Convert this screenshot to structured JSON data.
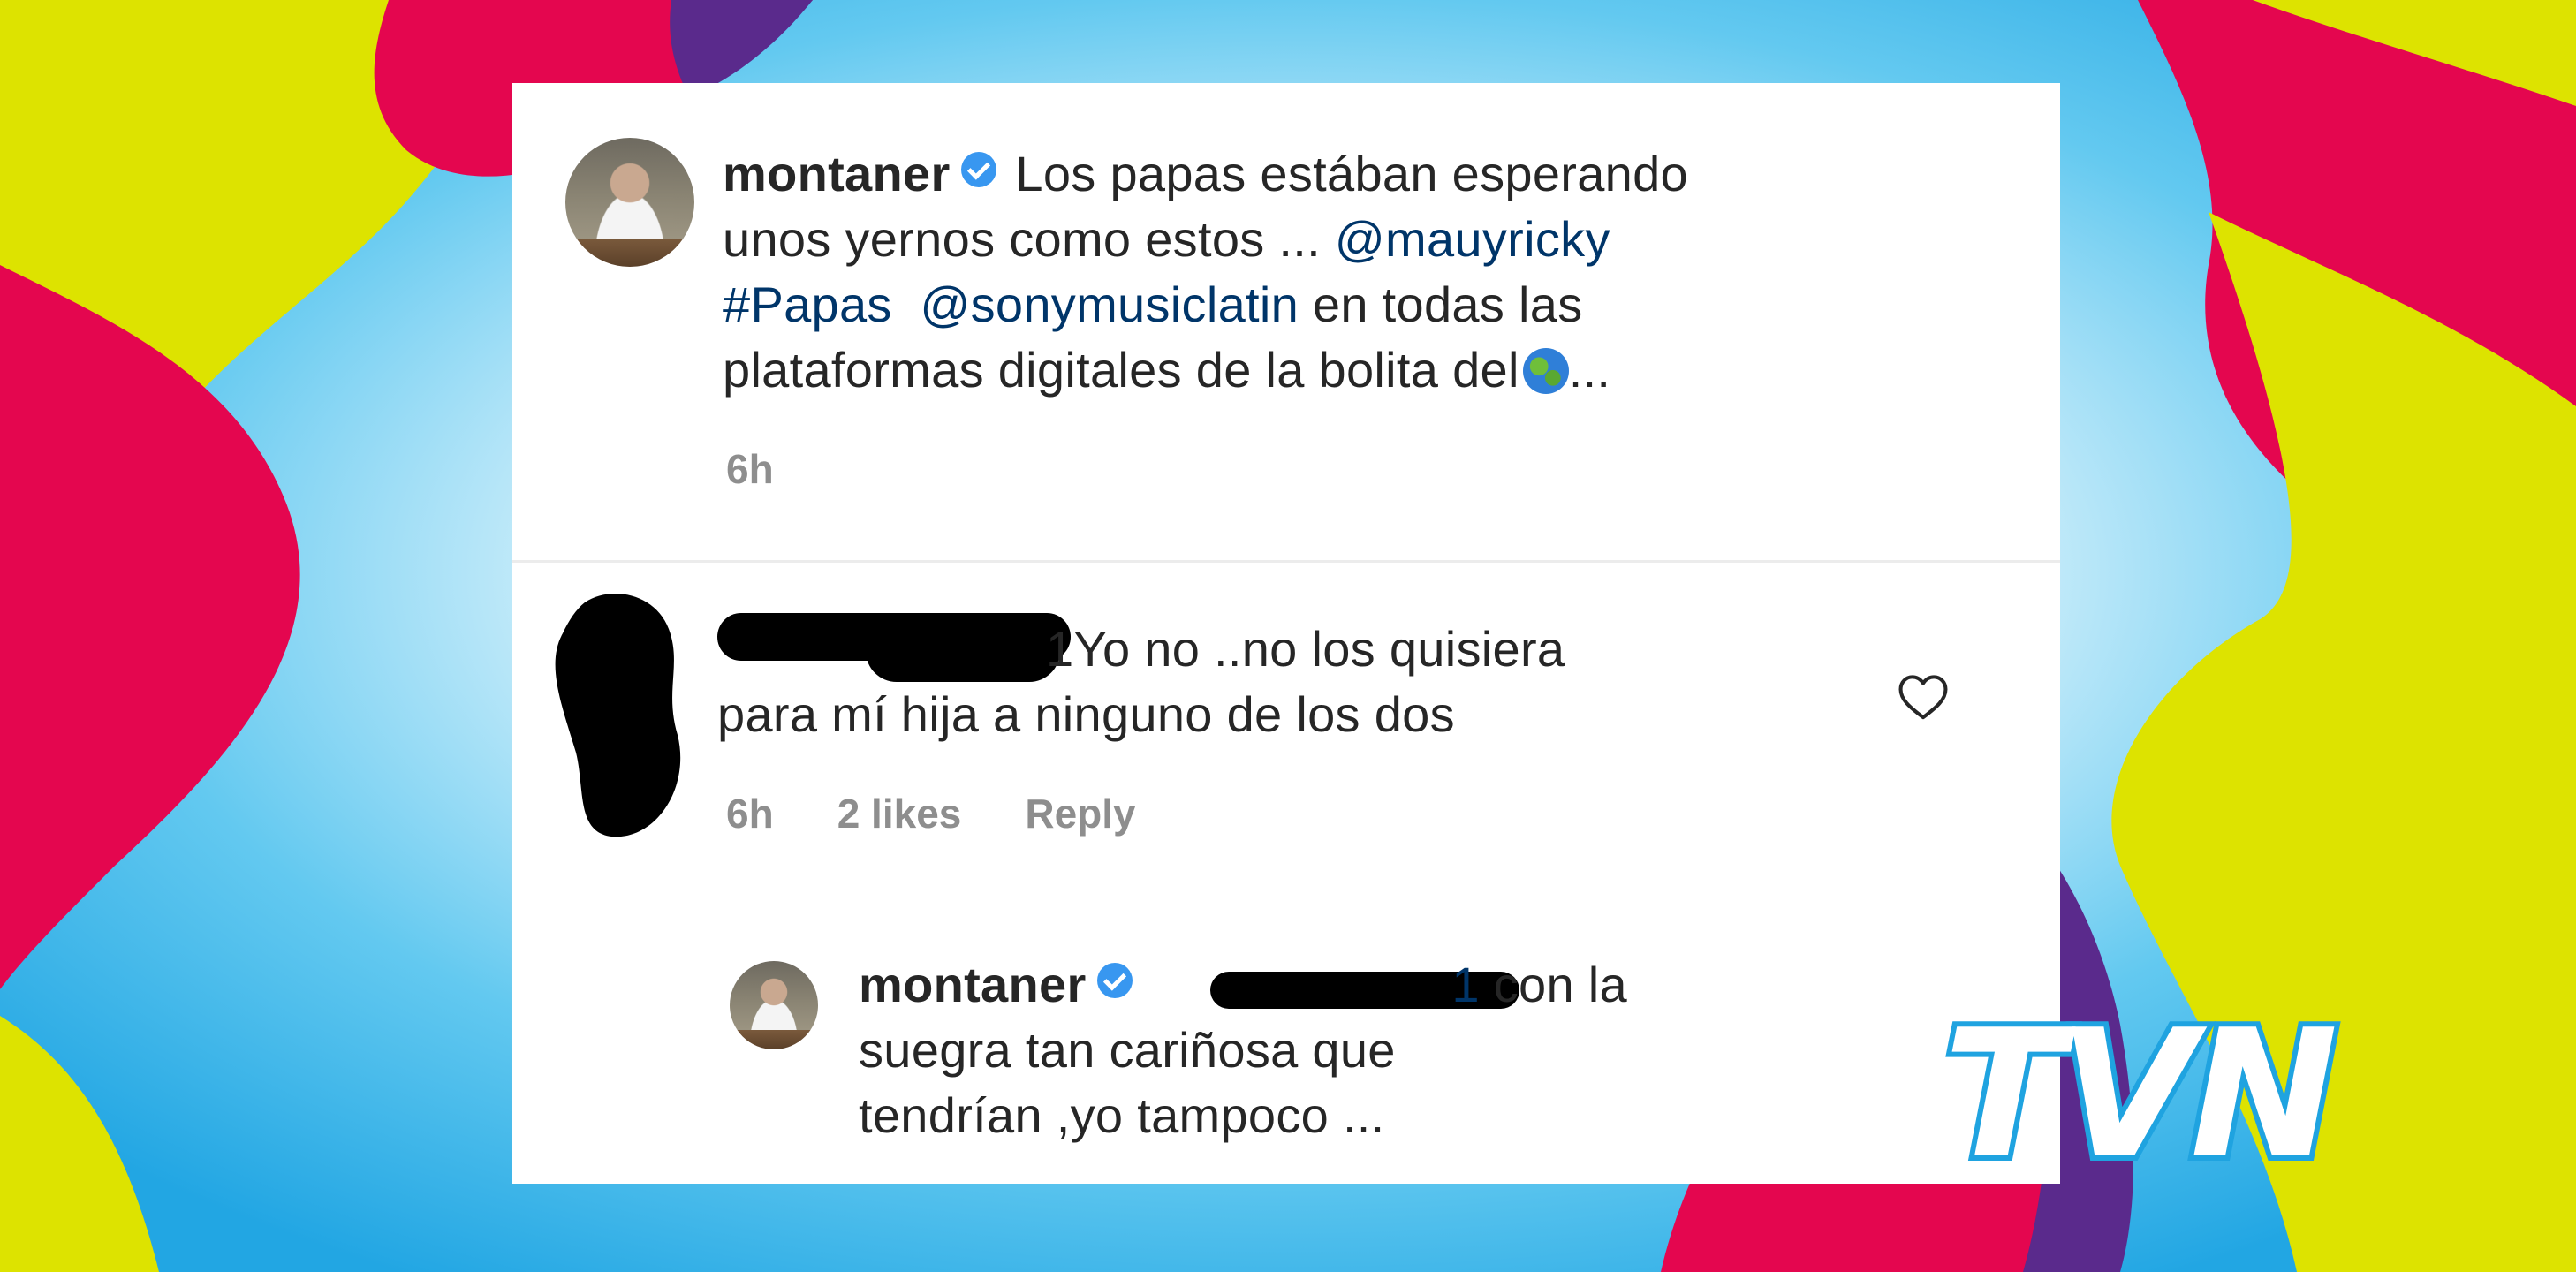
{
  "post": {
    "username": "montaner",
    "caption_lines": [
      "Los papas estában esperando",
      "unos yernos como estos ...",
      "@mauyricky",
      "#Papas",
      "@sonymusiclatin",
      "en todas las",
      "plataformas digitales de la bolita del",
      "..."
    ],
    "time": "6h"
  },
  "comment": {
    "username_suffix": "1",
    "text_line1": "Yo no ..no los quisiera",
    "text_line2": "para mí hija a ninguno de los dos",
    "time": "6h",
    "likes": "2 likes",
    "reply_label": "Reply"
  },
  "reply": {
    "username": "montaner",
    "mention_suffix": "1",
    "text_line1": "con la",
    "text_line2": "suegra tan cariñosa que",
    "text_line3": "tendrían ,yo tampoco ..."
  },
  "brand": {
    "logo_text": "TVN"
  },
  "colors": {
    "accent_link": "#003569",
    "verified": "#3897f0",
    "meta_gray": "#8e8e8e",
    "bg_red": "#e4064f",
    "bg_yellow": "#dde300",
    "bg_purple": "#5a2a8c",
    "bg_blue": "#5cc3ee"
  },
  "icons": [
    "verified-badge-icon",
    "globe-emoji-icon",
    "heart-icon"
  ]
}
